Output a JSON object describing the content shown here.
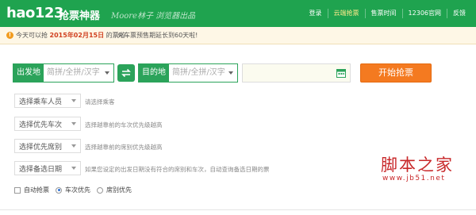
{
  "header": {
    "logo": "hao123",
    "title": "抢票神器",
    "watermark": "Moore林子 浏览器出品",
    "nav": [
      {
        "label": "登录",
        "active": false
      },
      {
        "label": "云端抢票",
        "active": true
      },
      {
        "label": "售票时间",
        "active": false
      },
      {
        "label": "12306官网",
        "active": false
      },
      {
        "label": "反馈",
        "active": false
      }
    ]
  },
  "notice": {
    "icon": "info-icon",
    "prefix": "今天可以抢",
    "date": "2015年02月15日",
    "suffix": "的票啦",
    "extra": "火车票预售期延长到60天啦!"
  },
  "search": {
    "from_label": "出发地",
    "from_placeholder": "简拼/全拼/汉字",
    "to_label": "目的地",
    "to_placeholder": "简拼/全拼/汉字",
    "date_value": "",
    "start_button": "开始抢票"
  },
  "filters": [
    {
      "label": "选择乘车人员",
      "hint": "请选择乘客"
    },
    {
      "label": "选择优先车次",
      "hint": "选择越靠前的车次优先级越高"
    },
    {
      "label": "选择优先席别",
      "hint": "选择越靠前的席别优先级越高"
    },
    {
      "label": "选择备选日期",
      "hint": "如果您设定的出发日期没有符合的席别和车次，自动查询备选日期的票"
    }
  ],
  "options": {
    "auto_grab": "自动抢票",
    "train_first": "车次优先",
    "seat_first": "席别优先",
    "selected": "train_first"
  },
  "watermark": {
    "name": "脚本之家",
    "url": "www.jb51.net"
  },
  "colors": {
    "brand_green": "#1fa34f",
    "accent_orange": "#f47a20",
    "watermark_red": "#c8282a"
  }
}
